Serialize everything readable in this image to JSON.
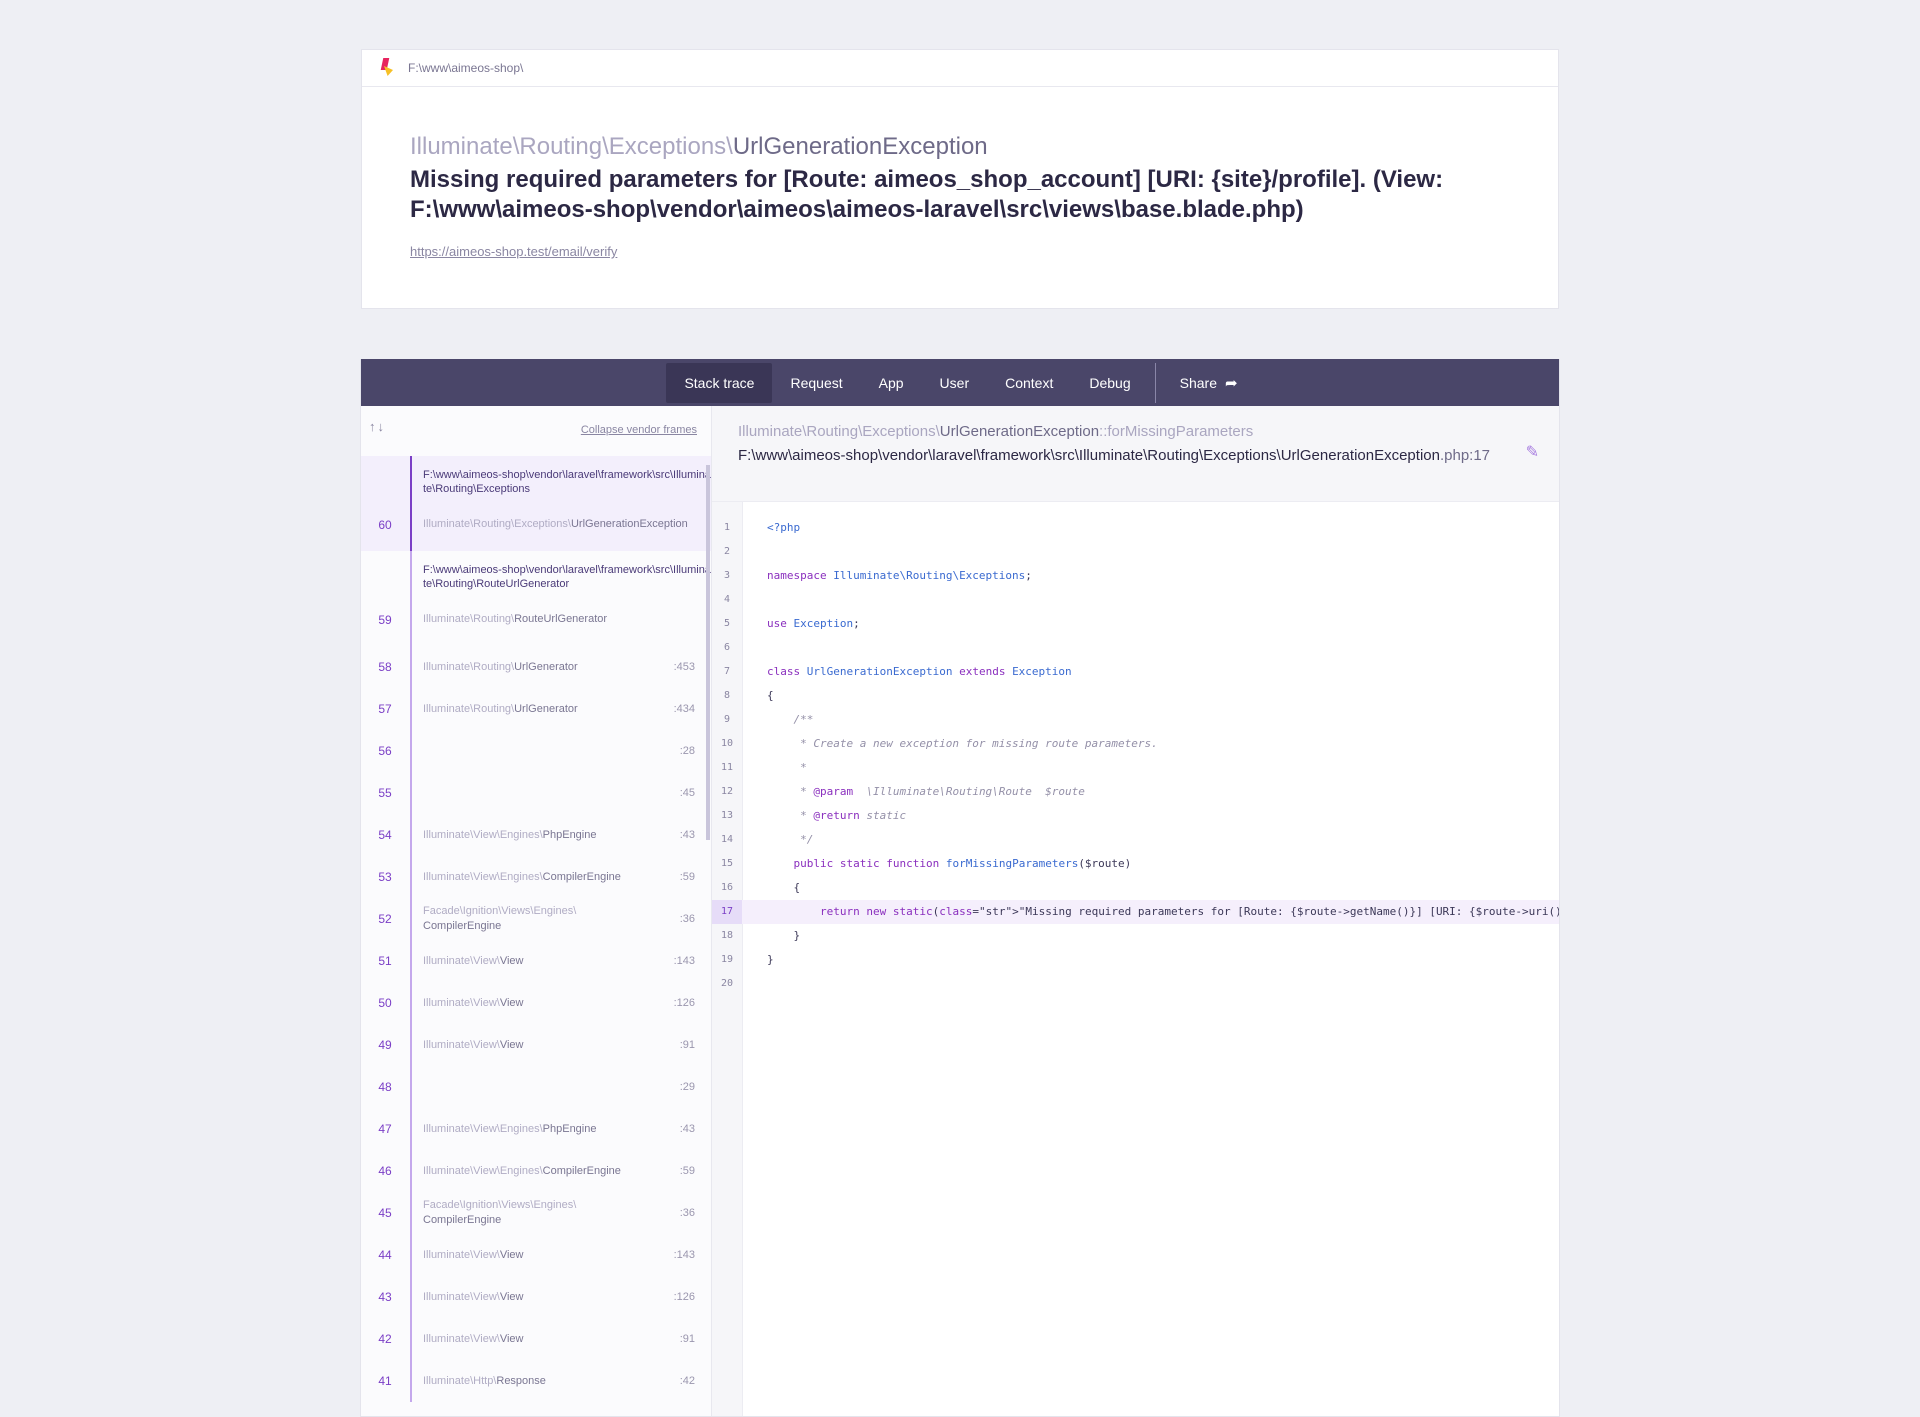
{
  "header": {
    "app_path": "F:\\www\\aimeos-shop\\",
    "exception_prefix": "Illuminate\\Routing\\Exceptions\\",
    "exception_name": "UrlGenerationException",
    "message": "Missing required parameters for [Route: aimeos_shop_account] [URI: {site}/profile]. (View: F:\\www\\aimeos-shop\\vendor\\aimeos\\aimeos-laravel\\src\\views\\base.blade.php)",
    "url": "https://aimeos-shop.test/email/verify"
  },
  "nav": {
    "tabs": [
      "Stack trace",
      "Request",
      "App",
      "User",
      "Context",
      "Debug"
    ],
    "share": "Share"
  },
  "frames_panel": {
    "arrows": "↑↓",
    "collapse": "Collapse vendor frames",
    "frames": [
      {
        "num": "60",
        "file": "F:\\www\\aimeos-shop\\vendor\\laravel\\framework\\src\\Illuminate\\Routing\\Exceptions",
        "prefix": "Illuminate\\Routing\\Exceptions\\",
        "name": "UrlGenerationException",
        "line": "",
        "selected": true
      },
      {
        "num": "59",
        "file": "F:\\www\\aimeos-shop\\vendor\\laravel\\framework\\src\\Illuminate\\Routing\\RouteUrlGenerator",
        "prefix": "Illuminate\\Routing\\",
        "name": "RouteUrlGenerator",
        "line": ""
      },
      {
        "num": "58",
        "prefix": "Illuminate\\Routing\\",
        "name": "UrlGenerator",
        "line": ":453"
      },
      {
        "num": "57",
        "prefix": "Illuminate\\Routing\\",
        "name": "UrlGenerator",
        "line": ":434"
      },
      {
        "num": "56",
        "prefix": "",
        "name": "",
        "line": ":28"
      },
      {
        "num": "55",
        "prefix": "",
        "name": "",
        "line": ":45"
      },
      {
        "num": "54",
        "prefix": "Illuminate\\View\\Engines\\",
        "name": "PhpEngine",
        "line": ":43"
      },
      {
        "num": "53",
        "prefix": "Illuminate\\View\\Engines\\",
        "name": "CompilerEngine",
        "line": ":59"
      },
      {
        "num": "52",
        "prefix": "Facade\\Ignition\\Views\\Engines\\",
        "name": "CompilerEngine",
        "line": ":36"
      },
      {
        "num": "51",
        "prefix": "Illuminate\\View\\",
        "name": "View",
        "line": ":143"
      },
      {
        "num": "50",
        "prefix": "Illuminate\\View\\",
        "name": "View",
        "line": ":126"
      },
      {
        "num": "49",
        "prefix": "Illuminate\\View\\",
        "name": "View",
        "line": ":91"
      },
      {
        "num": "48",
        "prefix": "",
        "name": "",
        "line": ":29"
      },
      {
        "num": "47",
        "prefix": "Illuminate\\View\\Engines\\",
        "name": "PhpEngine",
        "line": ":43"
      },
      {
        "num": "46",
        "prefix": "Illuminate\\View\\Engines\\",
        "name": "CompilerEngine",
        "line": ":59"
      },
      {
        "num": "45",
        "prefix": "Facade\\Ignition\\Views\\Engines\\",
        "name": "CompilerEngine",
        "line": ":36"
      },
      {
        "num": "44",
        "prefix": "Illuminate\\View\\",
        "name": "View",
        "line": ":143"
      },
      {
        "num": "43",
        "prefix": "Illuminate\\View\\",
        "name": "View",
        "line": ":126"
      },
      {
        "num": "42",
        "prefix": "Illuminate\\View\\",
        "name": "View",
        "line": ":91"
      },
      {
        "num": "41",
        "prefix": "Illuminate\\Http\\",
        "name": "Response",
        "line": ":42"
      }
    ]
  },
  "detail": {
    "class_prefix": "Illuminate\\Routing\\Exceptions\\",
    "class_name": "UrlGenerationException",
    "method": "::forMissingParameters",
    "file": "F:\\www\\aimeos-shop\\vendor\\laravel\\framework\\src\\Illuminate\\Routing\\Exceptions\\UrlGenerationException",
    "file_suffix": ".php:17",
    "highlight_line": 17,
    "code_lines": [
      "<?php",
      "",
      "namespace Illuminate\\Routing\\Exceptions;",
      "",
      "use Exception;",
      "",
      "class UrlGenerationException extends Exception",
      "{",
      "    /**",
      "     * Create a new exception for missing route parameters.",
      "     *",
      "     * @param  \\Illuminate\\Routing\\Route  $route",
      "     * @return static",
      "     */",
      "    public static function forMissingParameters($route)",
      "    {",
      "        return new static(\"Missing required parameters for [Route: {$route->getName()}] [URI: {$route->uri()}].\");",
      "    }",
      "}",
      ""
    ]
  }
}
